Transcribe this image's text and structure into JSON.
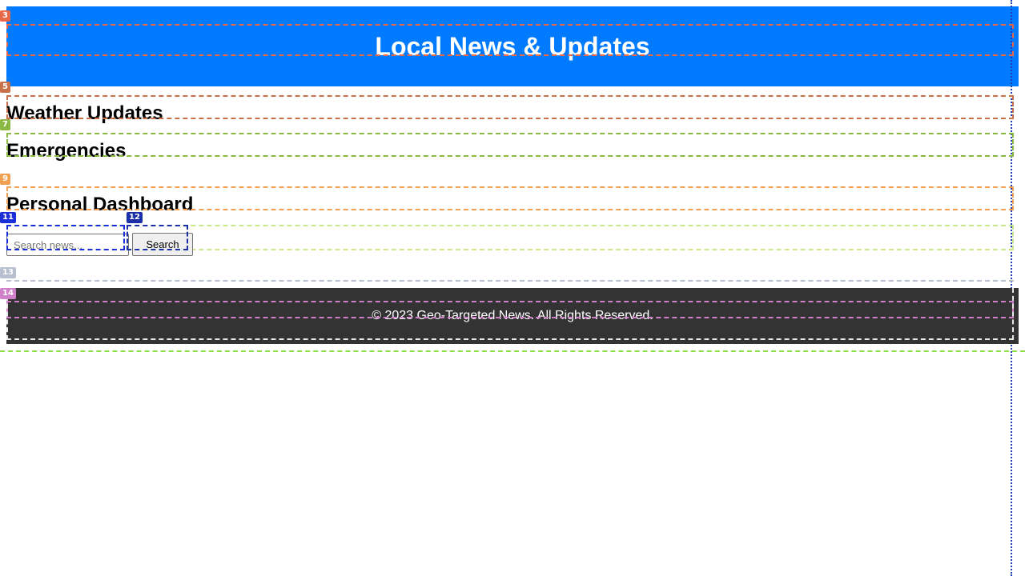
{
  "header": {
    "title": "Local News & Updates"
  },
  "sections": {
    "weather": "Weather Updates",
    "emergencies": "Emergencies",
    "dashboard": "Personal Dashboard"
  },
  "search": {
    "placeholder": "Search news...",
    "value": "",
    "button_label": "Search"
  },
  "footer": {
    "text": "© 2023 Geo-Targeted News. All Rights Reserved."
  },
  "overlay_tags": {
    "header": "3",
    "weather": "5",
    "emergencies": "7",
    "dashboard": "9",
    "search_input": "11",
    "search_button": "12",
    "search_section": "13",
    "footer": "14"
  },
  "colors": {
    "header_bg": "#007bff",
    "footer_bg": "#333333",
    "tag_header": "#e8684a",
    "tag_weather": "#c8704a",
    "tag_emergencies": "#8ab840",
    "tag_dashboard": "#f0a050",
    "tag_search_input": "#1a2fd8",
    "tag_search_button": "#1a2fa8",
    "tag_search_section": "#b8c0d0",
    "tag_footer": "#d080c8"
  }
}
